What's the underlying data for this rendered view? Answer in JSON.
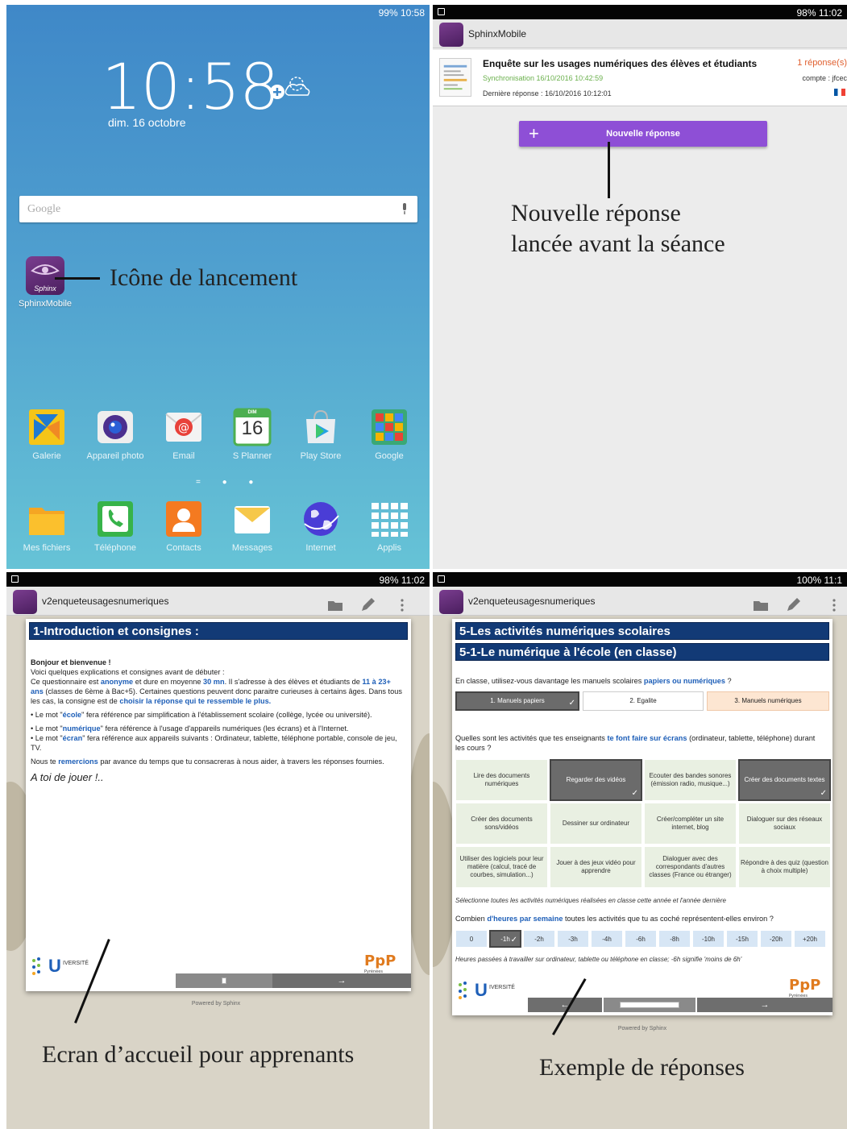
{
  "panel1": {
    "status": "99% 10:58",
    "time": "10:58",
    "date": "dim. 16 octobre",
    "search_placeholder": "Google",
    "launcher_app_label": "SphinxMobile",
    "launcher_icon_text": "Sphinx",
    "annotation": "Icône de lancement",
    "apps_row1": [
      "Galerie",
      "Appareil photo",
      "Email",
      "S Planner",
      "Play Store",
      "Google"
    ],
    "apps_row2": [
      "Mes fichiers",
      "Téléphone",
      "Contacts",
      "Messages",
      "Internet",
      "Applis"
    ],
    "calendar_day": "DIM",
    "calendar_date": "16"
  },
  "panel2": {
    "status": "98% 11:02",
    "app_title": "SphinxMobile",
    "survey_title": "Enquête sur les usages numériques des élèves et étudiants",
    "sync": "Synchronisation 16/10/2016 10:42:59",
    "last_response": "Dernière réponse : 16/10/2016 10:12:01",
    "responses": "1 réponse(s)",
    "account": "compte : jfcec",
    "new_button": "Nouvelle réponse",
    "annotation_line1": "Nouvelle réponse",
    "annotation_line2": "lancée avant la séance"
  },
  "panel3": {
    "status": "98% 11:02",
    "app_title": "v2enqueteusagesnumeriques",
    "section_title": "1-Introduction et consignes :",
    "greeting": "Bonjour et bienvenue !",
    "p1": "Voici quelques explications et consignes avant de débuter :",
    "p2a": "Ce questionnaire est ",
    "p2b": "anonyme",
    "p2c": " et dure en moyenne ",
    "p2d": "30 mn",
    "p2e": ". Il s'adresse à des élèves et étudiants de ",
    "p2f": "11 à 23+ ans",
    "p2g": " (classes de 6ème à Bac+5). Certaines questions peuvent donc paraitre curieuses à certains âges. Dans tous les cas, la consigne est de ",
    "p2h": "choisir la réponse qui te ressemble le plus.",
    "p3a": "• Le mot \"",
    "p3b": "école",
    "p3c": "\" fera référence par simplification à l'établissement scolaire (collège, lycée ou université).",
    "p4a": "• Le mot \"",
    "p4b": "numérique",
    "p4c": "\" fera référence à l'usage d'appareils numériques (les écrans) et à l'Internet.",
    "p5a": "• Le mot \"",
    "p5b": "écran",
    "p5c": "\" fera référence aux appareils suivants : Ordinateur, tablette, téléphone portable, console de jeu, TV.",
    "p6a": "Nous te ",
    "p6b": "remercions",
    "p6c": " par avance du temps que tu consacreras à nous aider, à travers les réponses fournies.",
    "closing": "A toi de jouer !..",
    "logo_u": "U",
    "logo_u_text": "IVERSITÉ",
    "ppp": "PpP",
    "ppp_sub": "Pyrénées",
    "next_arrow": "→",
    "powered": "Powered by Sphinx",
    "annotation": "Ecran d’accueil pour apprenants"
  },
  "panel4": {
    "status": "100% 11:1",
    "app_title": "v2enqueteusagesnumeriques",
    "header1": "5-Les activités numériques scolaires",
    "header2": "5-1-Le numérique à l'école (en classe)",
    "q1a": "En classe, utilisez-vous davantage les manuels scolaires ",
    "q1b": "papiers ou numériques",
    "q1c": " ?",
    "q1_opts": [
      "1. Manuels papiers",
      "2. Egalite",
      "3. Manuels numériques"
    ],
    "q2a": "Quelles sont les activités que tes enseignants ",
    "q2b": "te font faire sur écrans",
    "q2c": " (ordinateur, tablette, téléphone) durant les cours ?",
    "activities": [
      "Lire des documents numériques",
      "Regarder des vidéos",
      "Ecouter des bandes sonores (émission radio, musique...)",
      "Créer des documents textes",
      "Créer des documents sons/vidéos",
      "Dessiner sur ordinateur",
      "Créer/compléter un site internet, blog",
      "Dialoguer sur des réseaux sociaux",
      "Utiliser des logiciels pour leur matière (calcul, tracé de courbes, simulation...)",
      "Jouer à des jeux vidéo pour apprendre",
      "Dialoguer avec des correspondants d'autres classes (France ou étranger)",
      "Répondre à des quiz (question à choix multiple)"
    ],
    "note1": "Sélectionne toutes les activités numériques réalisées en classe cette année et l'année dernière",
    "q3a": "Combien ",
    "q3b": "d'heures par semaine",
    "q3c": " toutes les activités que tu as coché représentent-elles environ ?",
    "hours": [
      "0",
      "-1h",
      "-2h",
      "-3h",
      "-4h",
      "-6h",
      "-8h",
      "-10h",
      "-15h",
      "-20h",
      "+20h"
    ],
    "note2": "Heures passées à travailler sur ordinateur, tablette ou téléphone en classe; -6h signifie 'moins de 6h'",
    "check": "✓",
    "nav_prev": "←",
    "nav_next": "→",
    "powered": "Powered by Sphinx",
    "annotation": "Exemple de réponses"
  }
}
